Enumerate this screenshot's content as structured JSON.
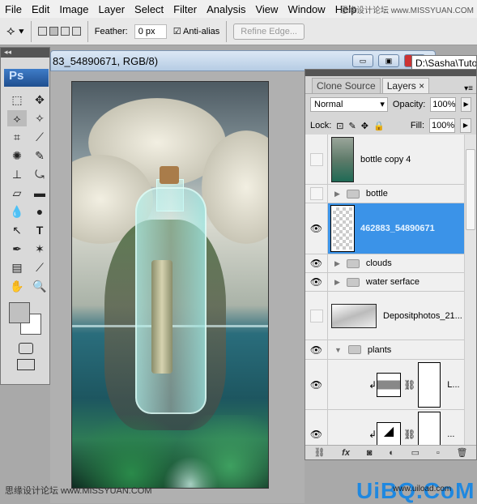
{
  "menu": [
    "File",
    "Edit",
    "Image",
    "Layer",
    "Select",
    "Filter",
    "Analysis",
    "View",
    "Window",
    "Help"
  ],
  "watermark_top": "思缘设计论坛 www.MISSYUAN.COM",
  "watermark_bottom_left": "思缘设计论坛 www.MISSYUAN.COM",
  "watermark_bottom_right": "UiBQ.CoM",
  "watermark_bottom_url": "www.uiload.com",
  "options": {
    "feather_label": "Feather:",
    "feather_value": "0 px",
    "antialias_label": "Anti-alias",
    "antialias_checked": true,
    "refine_edge": "Refine Edge..."
  },
  "document": {
    "title": "83_54890671, RGB/8)",
    "tooltip": "D:\\Sasha\\Tutor"
  },
  "toolbox": {
    "logo": "Ps",
    "collapse": "◂◂"
  },
  "layers_panel": {
    "tabs": [
      "Clone Source",
      "Layers"
    ],
    "active_tab": "Layers",
    "blend_mode": "Normal",
    "opacity_label": "Opacity:",
    "opacity": "100%",
    "lock_label": "Lock:",
    "fill_label": "Fill:",
    "fill": "100%",
    "layers": [
      {
        "name": "bottle copy 4",
        "visible": false,
        "type": "layer"
      },
      {
        "name": "bottle",
        "visible": false,
        "type": "group"
      },
      {
        "name": "462883_54890671",
        "visible": true,
        "type": "layer",
        "selected": true
      },
      {
        "name": "clouds",
        "visible": true,
        "type": "group"
      },
      {
        "name": "water serface",
        "visible": true,
        "type": "group"
      },
      {
        "name": "Depositphotos_21...",
        "visible": false,
        "type": "layer"
      },
      {
        "name": "plants",
        "visible": true,
        "type": "group",
        "expanded": true
      },
      {
        "name": "L...",
        "visible": true,
        "type": "adjustment"
      },
      {
        "name": "...",
        "visible": true,
        "type": "adjustment"
      }
    ]
  }
}
